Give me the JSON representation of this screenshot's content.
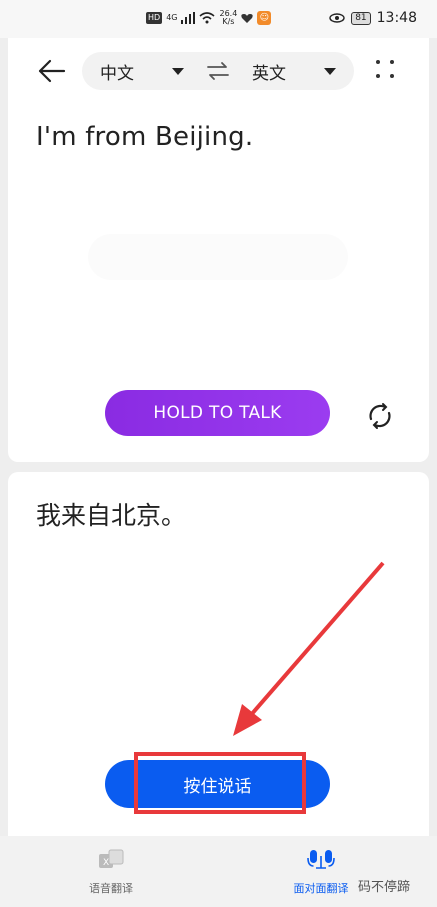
{
  "status_bar": {
    "hd": "HD",
    "network": "4G",
    "speed_value": "26.4",
    "speed_unit": "K/s",
    "battery": "81",
    "time": "13:48"
  },
  "toolbar": {
    "source_language": "中文",
    "target_language": "英文"
  },
  "source_text": "I'm from Beijing.",
  "hold_to_talk_label": "HOLD TO TALK",
  "target_text": "我来自北京。",
  "press_to_talk_label": "按住说话",
  "bottom_nav": {
    "voice_translate": "语音翻译",
    "face_to_face": "面对面翻译"
  },
  "watermark": "码不停蹄",
  "colors": {
    "purple_button": "#8a2be2",
    "blue_button": "#0a5cf0",
    "highlight_red": "#e8393b"
  }
}
